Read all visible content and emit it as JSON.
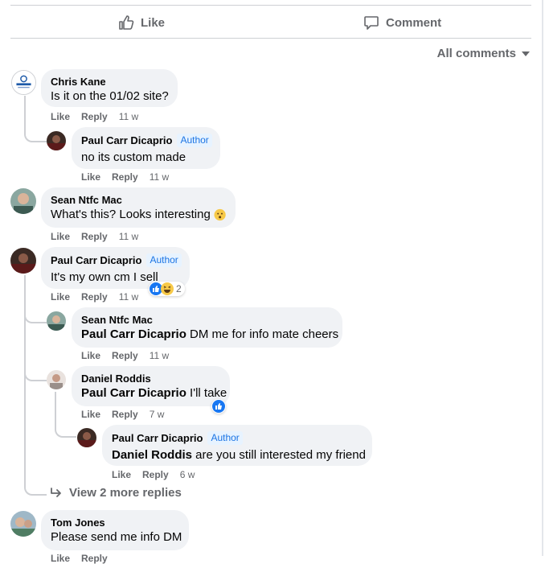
{
  "actions": {
    "like": "Like",
    "comment": "Comment"
  },
  "filter": {
    "label": "All comments"
  },
  "meta_labels": {
    "like": "Like",
    "reply": "Reply"
  },
  "view_more": "View 2 more replies",
  "colors": {
    "bubble": "#f0f2f5",
    "muted": "#65676b",
    "author_badge": "#1b74e4",
    "like_blue": "#1877f2"
  },
  "comments": [
    {
      "name": "Chris Kane",
      "text": "Is it on the 01/02 site?",
      "time": "11 w"
    },
    {
      "name": "Paul Carr Dicaprio",
      "badge": "Author",
      "text": "no its custom made",
      "time": "11 w"
    },
    {
      "name": "Sean Ntfc Mac",
      "text": "What's this? Looks interesting",
      "time": "11 w"
    },
    {
      "name": "Paul Carr Dicaprio",
      "badge": "Author",
      "text": "It's my own cm I sell",
      "time": "11 w",
      "reactions": "2"
    },
    {
      "name": "Sean Ntfc Mac",
      "mention": "Paul Carr Dicaprio",
      "text": " DM me for info mate cheers",
      "time": "11 w"
    },
    {
      "name": "Daniel Roddis",
      "mention": "Paul Carr Dicaprio",
      "text": " I'll take",
      "time": "7 w"
    },
    {
      "name": "Paul Carr Dicaprio",
      "badge": "Author",
      "mention": "Daniel Roddis",
      "text": " are you still interested my friend",
      "time": "6 w"
    },
    {
      "name": "Tom Jones",
      "text": "Please send me info DM"
    }
  ]
}
